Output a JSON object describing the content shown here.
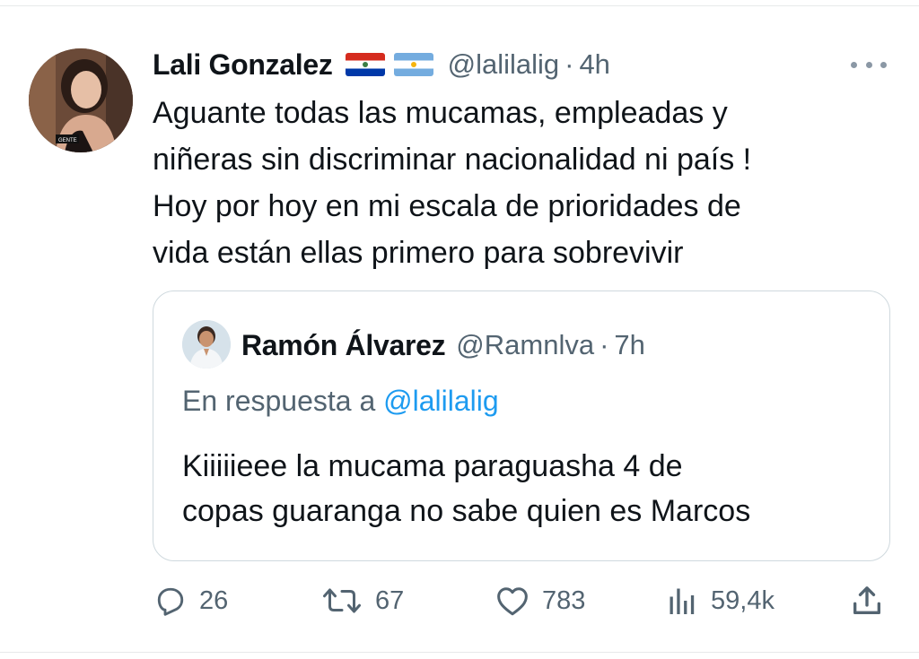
{
  "tweet": {
    "author": {
      "name": "Lali Gonzalez",
      "handle": "@lalilalig",
      "time": "4h",
      "flags": [
        "flag-paraguay-icon",
        "flag-argentina-icon"
      ],
      "avatar_badge": "GENTE"
    },
    "separator": "·",
    "text_lines": [
      "Aguante todas las mucamas, empleadas y",
      "niñeras sin discriminar nacionalidad ni país  !",
      "Hoy por hoy en mi escala de prioridades de",
      "vida están ellas primero para sobrevivir"
    ],
    "more_icon": "more-horizontal-icon"
  },
  "quoted": {
    "author": {
      "name": "Ramón Álvarez",
      "handle": "@Ramnlva",
      "time": "7h"
    },
    "reply_prefix": "En respuesta a",
    "reply_to": "@lalilalig",
    "text_lines": [
      "Kiiiiieee la mucama paraguasha 4 de",
      "copas guaranga no sabe quien es Marcos"
    ]
  },
  "actions": {
    "reply": {
      "icon": "reply-icon",
      "count": "26"
    },
    "retweet": {
      "icon": "retweet-icon",
      "count": "67"
    },
    "like": {
      "icon": "heart-icon",
      "count": "783"
    },
    "views": {
      "icon": "views-icon",
      "count": "59,4k"
    },
    "share": {
      "icon": "share-icon"
    }
  },
  "colors": {
    "text": "#0f1419",
    "secondary": "#536471",
    "link": "#1d9bf0",
    "border": "#cfd9de"
  }
}
